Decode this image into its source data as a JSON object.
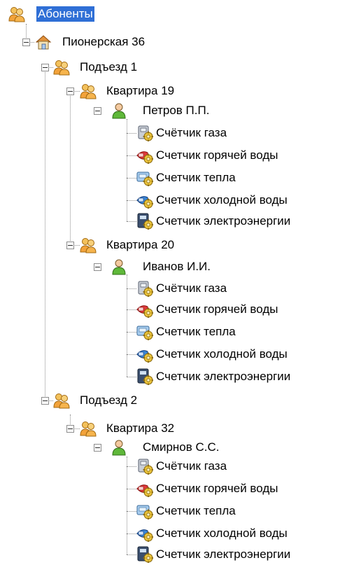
{
  "tree": {
    "root": {
      "label": "Абоненты",
      "icon": "group-users-icon"
    },
    "building": {
      "label": "Пионерская 36",
      "icon": "house-icon"
    },
    "entrances": [
      {
        "label": "Подъезд 1",
        "apartments": [
          {
            "label": "Квартира 19",
            "person": "Петров П.П.",
            "meters": [
              "Счётчик газа",
              "Счетчик горячей воды",
              "Счетчик тепла",
              "Счетчик холодной воды",
              "Счетчик электроэнергии"
            ]
          },
          {
            "label": "Квартира 20",
            "person": "Иванов И.И.",
            "meters": [
              "Счётчик газа",
              "Счетчик горячей воды",
              "Счетчик тепла",
              "Счетчик холодной воды",
              "Счетчик электроэнергии"
            ]
          }
        ]
      },
      {
        "label": "Подъезд 2",
        "apartments": [
          {
            "label": "Квартира 32",
            "person": "Смирнов С.С.",
            "meters": [
              "Счётчик газа",
              "Счетчик горячей воды",
              "Счетчик тепла",
              "Счетчик холодной воды",
              "Счетчик электроэнергии"
            ]
          }
        ]
      }
    ],
    "meter_icons": [
      "gas-meter-icon",
      "hot-water-meter-icon",
      "heat-meter-icon",
      "cold-water-meter-icon",
      "electricity-meter-icon"
    ],
    "colors": {
      "selection": "#2f6fd6",
      "connector": "#8c8c8c",
      "group": "#f2a23a",
      "person": "#5fb83a"
    }
  }
}
